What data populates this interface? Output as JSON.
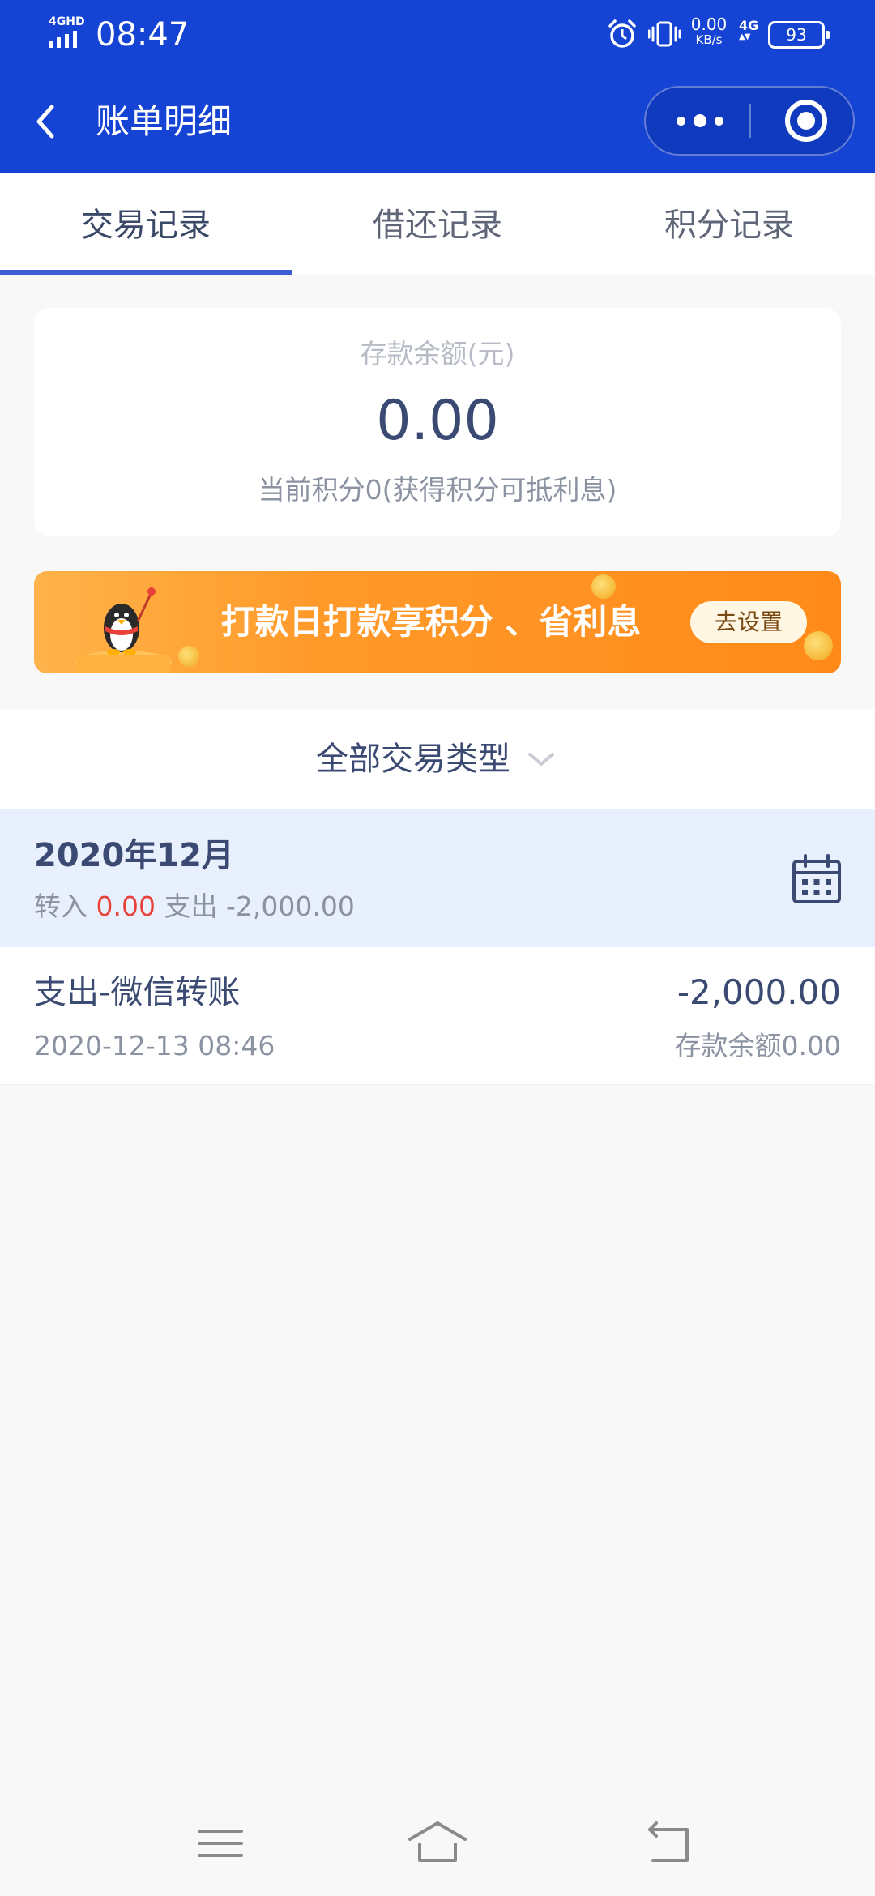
{
  "status_bar": {
    "network_badge": "4GHD",
    "time": "08:47",
    "speed_value": "0.00",
    "speed_unit": "KB/s",
    "network_type": "4G",
    "battery": "93"
  },
  "nav": {
    "title": "账单明细"
  },
  "tabs": [
    {
      "label": "交易记录",
      "active": true
    },
    {
      "label": "借还记录",
      "active": false
    },
    {
      "label": "积分记录",
      "active": false
    }
  ],
  "balance_card": {
    "label": "存款余额(元)",
    "amount": "0.00",
    "points_note": "当前积分0(获得积分可抵利息)"
  },
  "banner": {
    "text": "打款日打款享积分 、省利息",
    "button_label": "去设置"
  },
  "filter": {
    "label": "全部交易类型"
  },
  "month": {
    "title": "2020年12月",
    "in_label": "转入",
    "in_amount": "0.00",
    "out_label": "支出",
    "out_amount": "-2,000.00"
  },
  "transactions": [
    {
      "title": "支出-微信转账",
      "datetime": "2020-12-13 08:46",
      "amount": "-2,000.00",
      "balance_after": "存款余额0.00"
    }
  ],
  "colors": {
    "primary_blue": "#1544d4",
    "tab_underline": "#3b5dd1",
    "text_dark": "#3a4a72",
    "text_muted": "#8b92a2",
    "accent_red": "#e8413a",
    "banner_orange": "#ff8a1a",
    "month_bg": "#e9f0fd"
  },
  "icons": {
    "back": "chevron-left-icon",
    "more": "more-dots-icon",
    "close": "target-close-icon",
    "filter": "chevron-down-icon",
    "calendar": "calendar-icon",
    "sys_menu": "menu-icon",
    "sys_home": "home-icon",
    "sys_back": "back-arrow-icon"
  }
}
